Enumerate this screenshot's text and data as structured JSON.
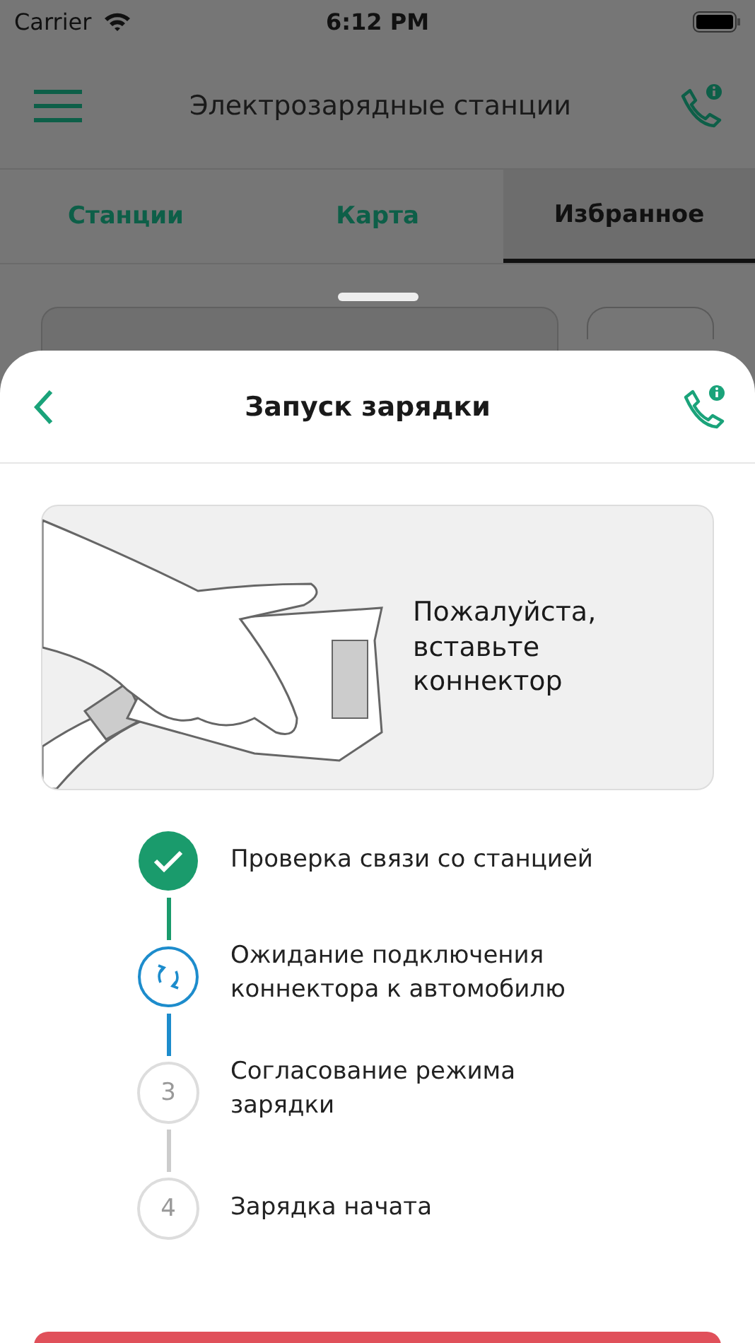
{
  "status_bar": {
    "carrier": "Carrier",
    "time": "6:12 PM"
  },
  "header": {
    "title": "Электрозарядные станции"
  },
  "tabs": [
    {
      "label": "Станции",
      "selected": false
    },
    {
      "label": "Карта",
      "selected": false
    },
    {
      "label": "Избранное",
      "selected": true
    }
  ],
  "sheet": {
    "title": "Запуск зарядки",
    "instruction": "Пожалуйста, вставьте коннектор",
    "steps": [
      {
        "kind": "done",
        "label": "Проверка связи со станцией"
      },
      {
        "kind": "active",
        "label": "Ожидание подключения коннектора к автомобилю"
      },
      {
        "kind": "pending",
        "number": "3",
        "label": "Согласование режима зарядки"
      },
      {
        "kind": "pending",
        "number": "4",
        "label": "Зарядка начата"
      }
    ]
  }
}
